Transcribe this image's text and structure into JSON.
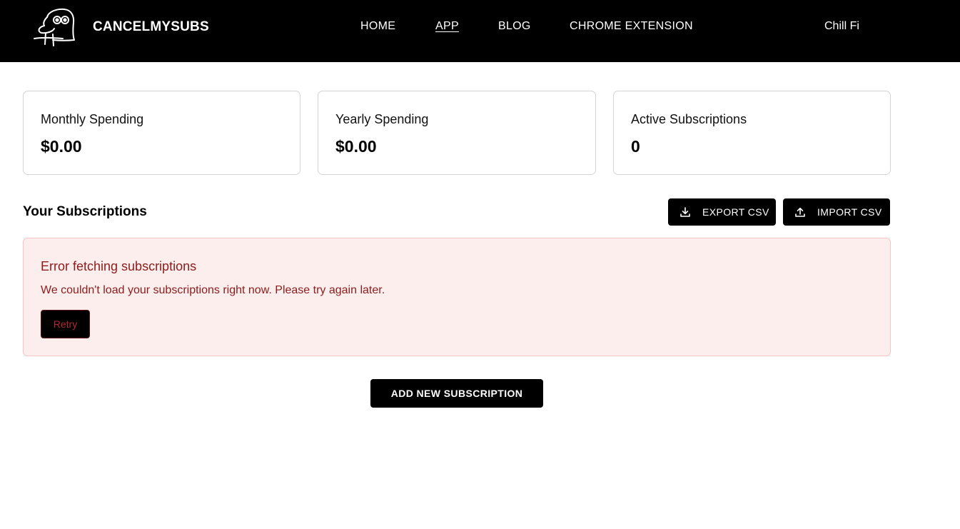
{
  "header": {
    "brand_name": "CANCELMYSUBS",
    "logo_icon": "doodle-bird-icon",
    "nav": [
      {
        "label": "HOME",
        "active": false
      },
      {
        "label": "APP",
        "active": true
      },
      {
        "label": "BLOG",
        "active": false
      },
      {
        "label": "CHROME EXTENSION",
        "active": false
      }
    ],
    "user_name": "Chill Fi"
  },
  "stats": [
    {
      "label": "Monthly Spending",
      "value": "$0.00"
    },
    {
      "label": "Yearly Spending",
      "value": "$0.00"
    },
    {
      "label": "Active Subscriptions",
      "value": "0"
    }
  ],
  "subscriptions": {
    "title": "Your Subscriptions",
    "export_label": "EXPORT CSV",
    "export_icon": "download-icon",
    "import_label": "IMPORT CSV",
    "import_icon": "upload-icon"
  },
  "error": {
    "title": "Error fetching subscriptions",
    "message": "We couldn't load your subscriptions right now. Please try again later.",
    "retry_label": "Retry"
  },
  "add_button_label": "ADD NEW SUBSCRIPTION",
  "colors": {
    "header_bg": "#000000",
    "error_bg": "#fdeeee",
    "error_border": "#f3c6c4",
    "error_text": "#8d1b1b"
  }
}
